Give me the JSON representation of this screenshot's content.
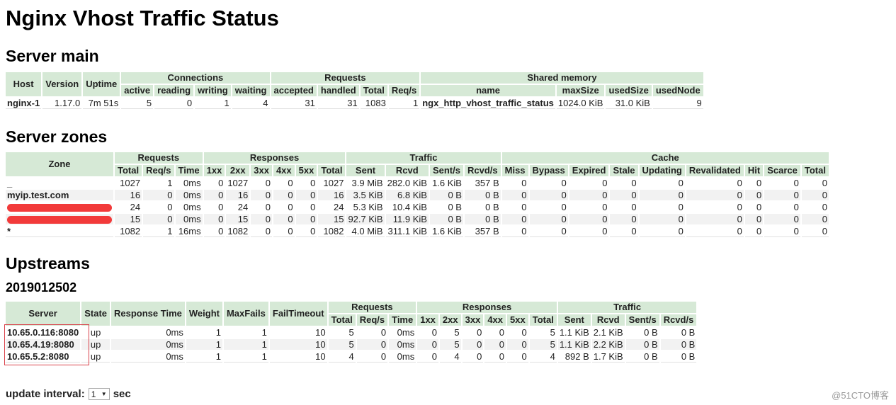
{
  "title": "Nginx Vhost Traffic Status",
  "server_main": {
    "heading": "Server main",
    "groups": {
      "connections": "Connections",
      "requests": "Requests",
      "shared_memory": "Shared memory"
    },
    "headers": {
      "host": "Host",
      "version": "Version",
      "uptime": "Uptime",
      "active": "active",
      "reading": "reading",
      "writing": "writing",
      "waiting": "waiting",
      "accepted": "accepted",
      "handled": "handled",
      "total": "Total",
      "reqs": "Req/s",
      "name": "name",
      "maxsize": "maxSize",
      "usedsize": "usedSize",
      "usednode": "usedNode"
    },
    "row": {
      "host": "nginx-1",
      "version": "1.17.0",
      "uptime": "7m 51s",
      "active": "5",
      "reading": "0",
      "writing": "1",
      "waiting": "4",
      "accepted": "31",
      "handled": "31",
      "total": "1083",
      "reqs": "1",
      "name": "ngx_http_vhost_traffic_status",
      "maxsize": "1024.0 KiB",
      "usedsize": "31.0 KiB",
      "usednode": "9"
    }
  },
  "server_zones": {
    "heading": "Server zones",
    "groups": {
      "zone": "Zone",
      "requests": "Requests",
      "responses": "Responses",
      "traffic": "Traffic",
      "cache": "Cache"
    },
    "headers": [
      "Total",
      "Req/s",
      "Time",
      "1xx",
      "2xx",
      "3xx",
      "4xx",
      "5xx",
      "Total",
      "Sent",
      "Rcvd",
      "Sent/s",
      "Rcvd/s",
      "Miss",
      "Bypass",
      "Expired",
      "Stale",
      "Updating",
      "Revalidated",
      "Hit",
      "Scarce",
      "Total"
    ],
    "rows": [
      {
        "zone": "_",
        "redacted": false,
        "cells": [
          "1027",
          "1",
          "0ms",
          "0",
          "1027",
          "0",
          "0",
          "0",
          "1027",
          "3.9 MiB",
          "282.0 KiB",
          "1.6 KiB",
          "357 B",
          "0",
          "0",
          "0",
          "0",
          "0",
          "0",
          "0",
          "0",
          "0"
        ]
      },
      {
        "zone": "myip.test.com",
        "redacted": false,
        "cells": [
          "16",
          "0",
          "0ms",
          "0",
          "16",
          "0",
          "0",
          "0",
          "16",
          "3.5 KiB",
          "6.8 KiB",
          "0 B",
          "0 B",
          "0",
          "0",
          "0",
          "0",
          "0",
          "0",
          "0",
          "0",
          "0"
        ]
      },
      {
        "zone": "",
        "redacted": true,
        "cells": [
          "24",
          "0",
          "0ms",
          "0",
          "24",
          "0",
          "0",
          "0",
          "24",
          "5.3 KiB",
          "10.4 KiB",
          "0 B",
          "0 B",
          "0",
          "0",
          "0",
          "0",
          "0",
          "0",
          "0",
          "0",
          "0"
        ]
      },
      {
        "zone": "",
        "redacted": true,
        "cells": [
          "15",
          "0",
          "0ms",
          "0",
          "15",
          "0",
          "0",
          "0",
          "15",
          "92.7 KiB",
          "11.9 KiB",
          "0 B",
          "0 B",
          "0",
          "0",
          "0",
          "0",
          "0",
          "0",
          "0",
          "0",
          "0"
        ]
      },
      {
        "zone": "*",
        "redacted": false,
        "cells": [
          "1082",
          "1",
          "16ms",
          "0",
          "1082",
          "0",
          "0",
          "0",
          "1082",
          "4.0 MiB",
          "311.1 KiB",
          "1.6 KiB",
          "357 B",
          "0",
          "0",
          "0",
          "0",
          "0",
          "0",
          "0",
          "0",
          "0"
        ]
      }
    ]
  },
  "upstreams": {
    "heading": "Upstreams",
    "group_name": "2019012502",
    "headers_left": {
      "server": "Server",
      "state": "State",
      "response_time": "Response Time",
      "weight": "Weight",
      "maxfails": "MaxFails",
      "failtimeout": "FailTimeout"
    },
    "groups": {
      "requests": "Requests",
      "responses": "Responses",
      "traffic": "Traffic"
    },
    "headers": [
      "Total",
      "Req/s",
      "Time",
      "1xx",
      "2xx",
      "3xx",
      "4xx",
      "5xx",
      "Total",
      "Sent",
      "Rcvd",
      "Sent/s",
      "Rcvd/s"
    ],
    "rows": [
      {
        "server": "10.65.0.116:8080",
        "state": "up",
        "response_time": "0ms",
        "weight": "1",
        "maxfails": "1",
        "failtimeout": "10",
        "cells": [
          "5",
          "0",
          "0ms",
          "0",
          "5",
          "0",
          "0",
          "0",
          "5",
          "1.1 KiB",
          "2.1 KiB",
          "0 B",
          "0 B"
        ]
      },
      {
        "server": "10.65.4.19:8080",
        "state": "up",
        "response_time": "0ms",
        "weight": "1",
        "maxfails": "1",
        "failtimeout": "10",
        "cells": [
          "5",
          "0",
          "0ms",
          "0",
          "5",
          "0",
          "0",
          "0",
          "5",
          "1.1 KiB",
          "2.2 KiB",
          "0 B",
          "0 B"
        ]
      },
      {
        "server": "10.65.5.2:8080",
        "state": "up",
        "response_time": "0ms",
        "weight": "1",
        "maxfails": "1",
        "failtimeout": "10",
        "cells": [
          "4",
          "0",
          "0ms",
          "0",
          "4",
          "0",
          "0",
          "0",
          "4",
          "892 B",
          "1.7 KiB",
          "0 B",
          "0 B"
        ]
      }
    ]
  },
  "footer": {
    "label": "update interval:",
    "interval_value": "1",
    "unit": "sec"
  },
  "watermark": "@51CTO博客",
  "colors": {
    "header_bg": "#d6e9d6",
    "alt_row": "#f2f2f2",
    "redaction": "#f23a3a",
    "highlight_box": "#d9424b"
  }
}
